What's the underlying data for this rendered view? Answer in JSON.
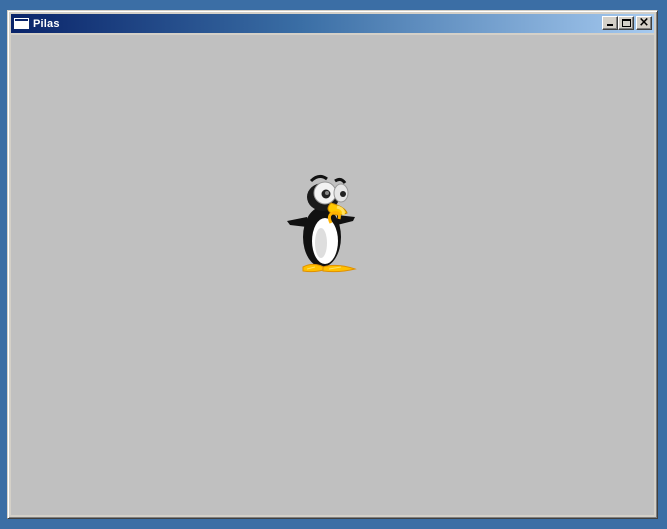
{
  "window": {
    "title": "Pilas",
    "buttons": {
      "minimize_icon": "minimize-icon",
      "maximize_icon": "maximize-icon",
      "close_icon": "close-icon"
    }
  },
  "canvas": {
    "background": "#c0c0c0",
    "sprite": "penguin"
  }
}
